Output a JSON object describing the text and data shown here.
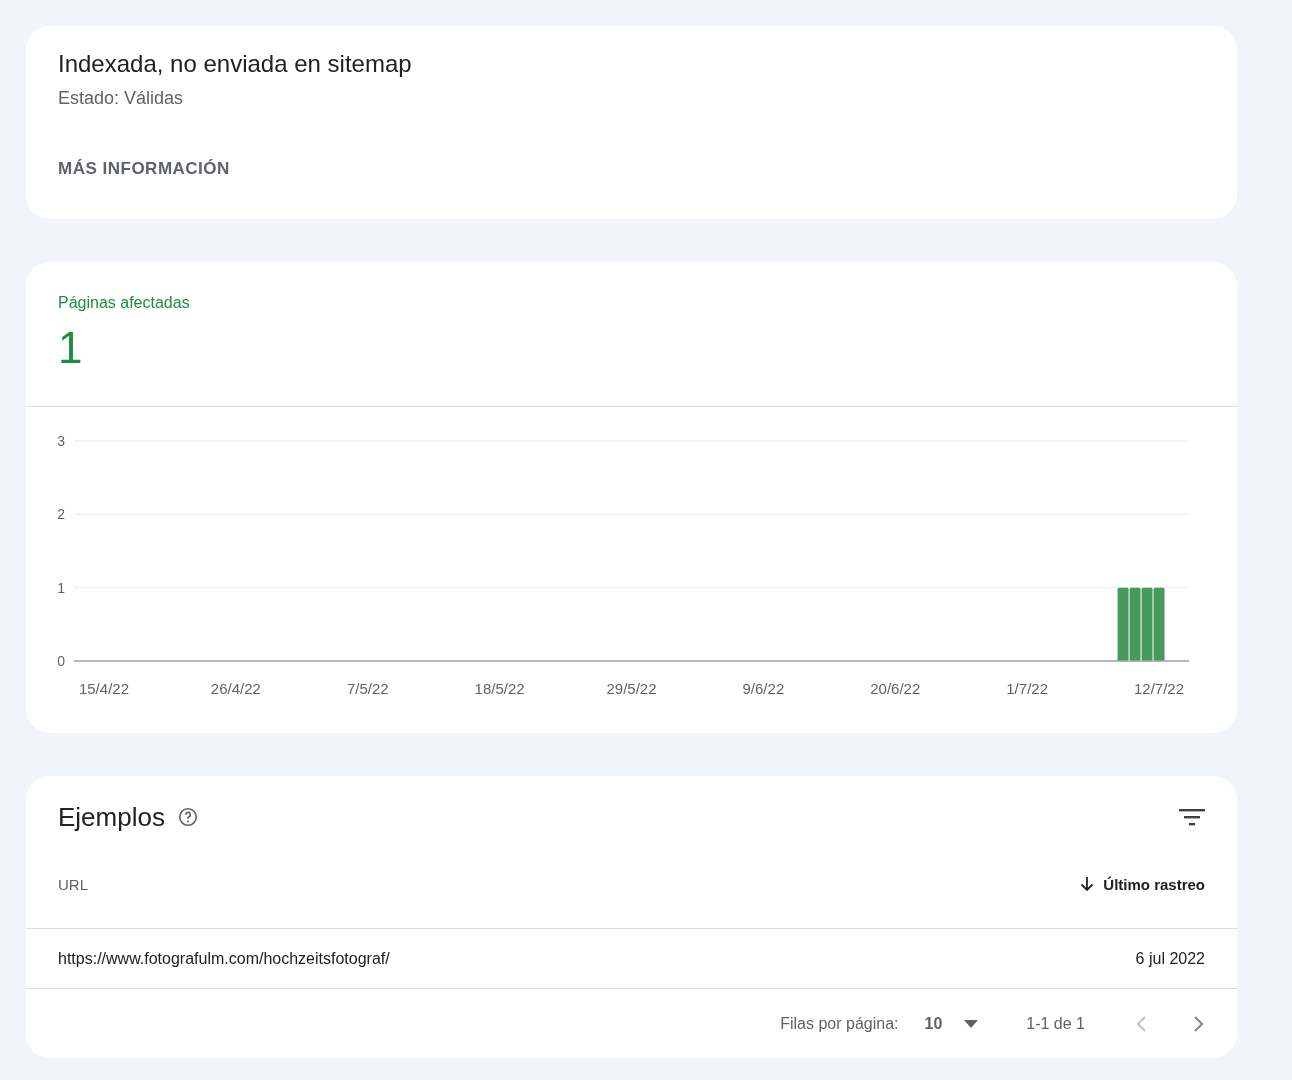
{
  "status_card": {
    "title": "Indexada, no enviada en sitemap",
    "status": "Estado: Válidas",
    "link": "MÁS INFORMACIÓN"
  },
  "affected_card": {
    "label": "Páginas afectadas",
    "count": "1",
    "chart_data": {
      "type": "bar",
      "ylim": [
        0,
        3
      ],
      "yticks": [
        0,
        1,
        2,
        3
      ],
      "categories": [
        null,
        null,
        "15/4/22",
        null,
        null,
        null,
        null,
        null,
        null,
        null,
        null,
        null,
        null,
        "26/4/22",
        null,
        null,
        null,
        null,
        null,
        null,
        null,
        null,
        null,
        null,
        "7/5/22",
        null,
        null,
        null,
        null,
        null,
        null,
        null,
        null,
        null,
        null,
        "18/5/22",
        null,
        null,
        null,
        null,
        null,
        null,
        null,
        null,
        null,
        null,
        "29/5/22",
        null,
        null,
        null,
        null,
        null,
        null,
        null,
        null,
        null,
        null,
        "9/6/22",
        null,
        null,
        null,
        null,
        null,
        null,
        null,
        null,
        null,
        null,
        "20/6/22",
        null,
        null,
        null,
        null,
        null,
        null,
        null,
        null,
        null,
        null,
        "1/7/22",
        null,
        null,
        null,
        null,
        null,
        null,
        null,
        null,
        null,
        null,
        "12/7/22",
        null,
        null
      ],
      "series": [
        {
          "color": "#469a5b",
          "values": [
            0,
            0,
            0,
            0,
            0,
            0,
            0,
            0,
            0,
            0,
            0,
            0,
            0,
            0,
            0,
            0,
            0,
            0,
            0,
            0,
            0,
            0,
            0,
            0,
            0,
            0,
            0,
            0,
            0,
            0,
            0,
            0,
            0,
            0,
            0,
            0,
            0,
            0,
            0,
            0,
            0,
            0,
            0,
            0,
            0,
            0,
            0,
            0,
            0,
            0,
            0,
            0,
            0,
            0,
            0,
            0,
            0,
            0,
            0,
            0,
            0,
            0,
            0,
            0,
            0,
            0,
            0,
            0,
            0,
            0,
            0,
            0,
            0,
            0,
            0,
            0,
            0,
            0,
            0,
            0,
            0,
            0,
            0,
            0,
            0,
            0,
            0,
            1,
            1,
            1,
            1,
            0,
            0
          ]
        }
      ]
    }
  },
  "examples_card": {
    "title": "Ejemplos",
    "columns": [
      {
        "label": "URL",
        "sorted": false
      },
      {
        "label": "Último rastreo",
        "sorted": true
      }
    ],
    "rows": [
      {
        "url": "https://www.fotografulm.com/hochzeitsfotograf/",
        "last_crawl": "6 jul 2022"
      }
    ],
    "pagination": {
      "rows_label": "Filas por página:",
      "rows_value": "10",
      "range": "1-1 de 1",
      "prev_disabled": true,
      "next_disabled": false
    }
  }
}
